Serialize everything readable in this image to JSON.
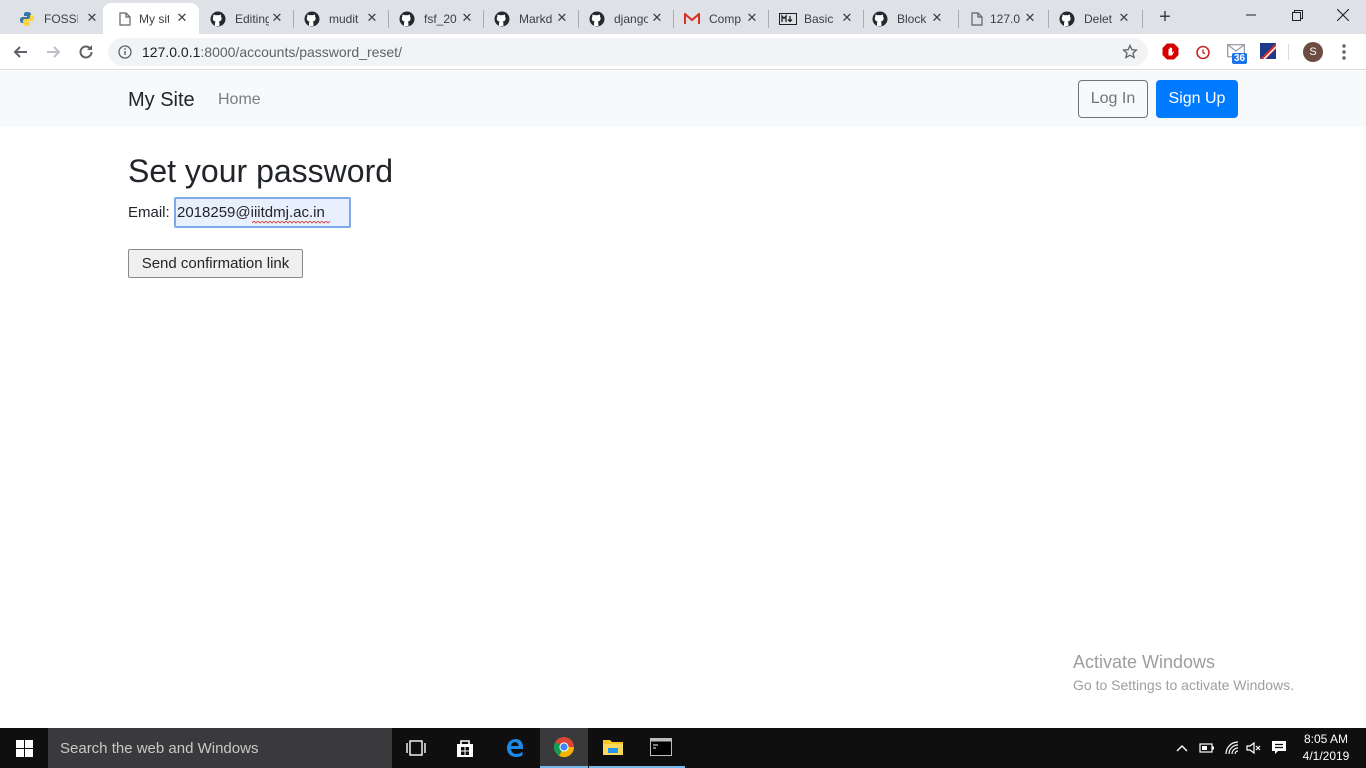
{
  "browser": {
    "tabs": [
      {
        "title": "FOSSEE",
        "icon": "python-icon"
      },
      {
        "title": "My site",
        "icon": "page-icon"
      },
      {
        "title": "Editing",
        "icon": "github-icon"
      },
      {
        "title": "mudit",
        "icon": "github-icon"
      },
      {
        "title": "fsf_20",
        "icon": "github-icon"
      },
      {
        "title": "Markd",
        "icon": "github-icon"
      },
      {
        "title": "django",
        "icon": "github-icon"
      },
      {
        "title": "Comp",
        "icon": "gmail-icon"
      },
      {
        "title": "Basic",
        "icon": "markdown-icon"
      },
      {
        "title": "Block",
        "icon": "github-icon"
      },
      {
        "title": "127.0",
        "icon": "page-icon"
      },
      {
        "title": "Delet",
        "icon": "github-icon"
      }
    ],
    "url_host": "127.0.0.1",
    "url_rest": ":8000/accounts/password_reset/",
    "profile_initial": "S",
    "mail_badge": "36"
  },
  "site": {
    "brand": "My Site",
    "nav_home": "Home",
    "login": "Log In",
    "signup": "Sign Up"
  },
  "form": {
    "heading": "Set your password",
    "email_label": "Email:",
    "email_value": "2018259@iiitdmj.ac.in",
    "submit": "Send confirmation link"
  },
  "watermark": {
    "line1": "Activate Windows",
    "line2": "Go to Settings to activate Windows."
  },
  "taskbar": {
    "search_placeholder": "Search the web and Windows",
    "time": "8:05 AM",
    "date": "4/1/2019"
  },
  "colors": {
    "primary": "#007bff",
    "navbar_bg": "#f8f9fa",
    "tabstrip_bg": "#dee1e6",
    "taskbar_bg": "#0f0f10"
  }
}
